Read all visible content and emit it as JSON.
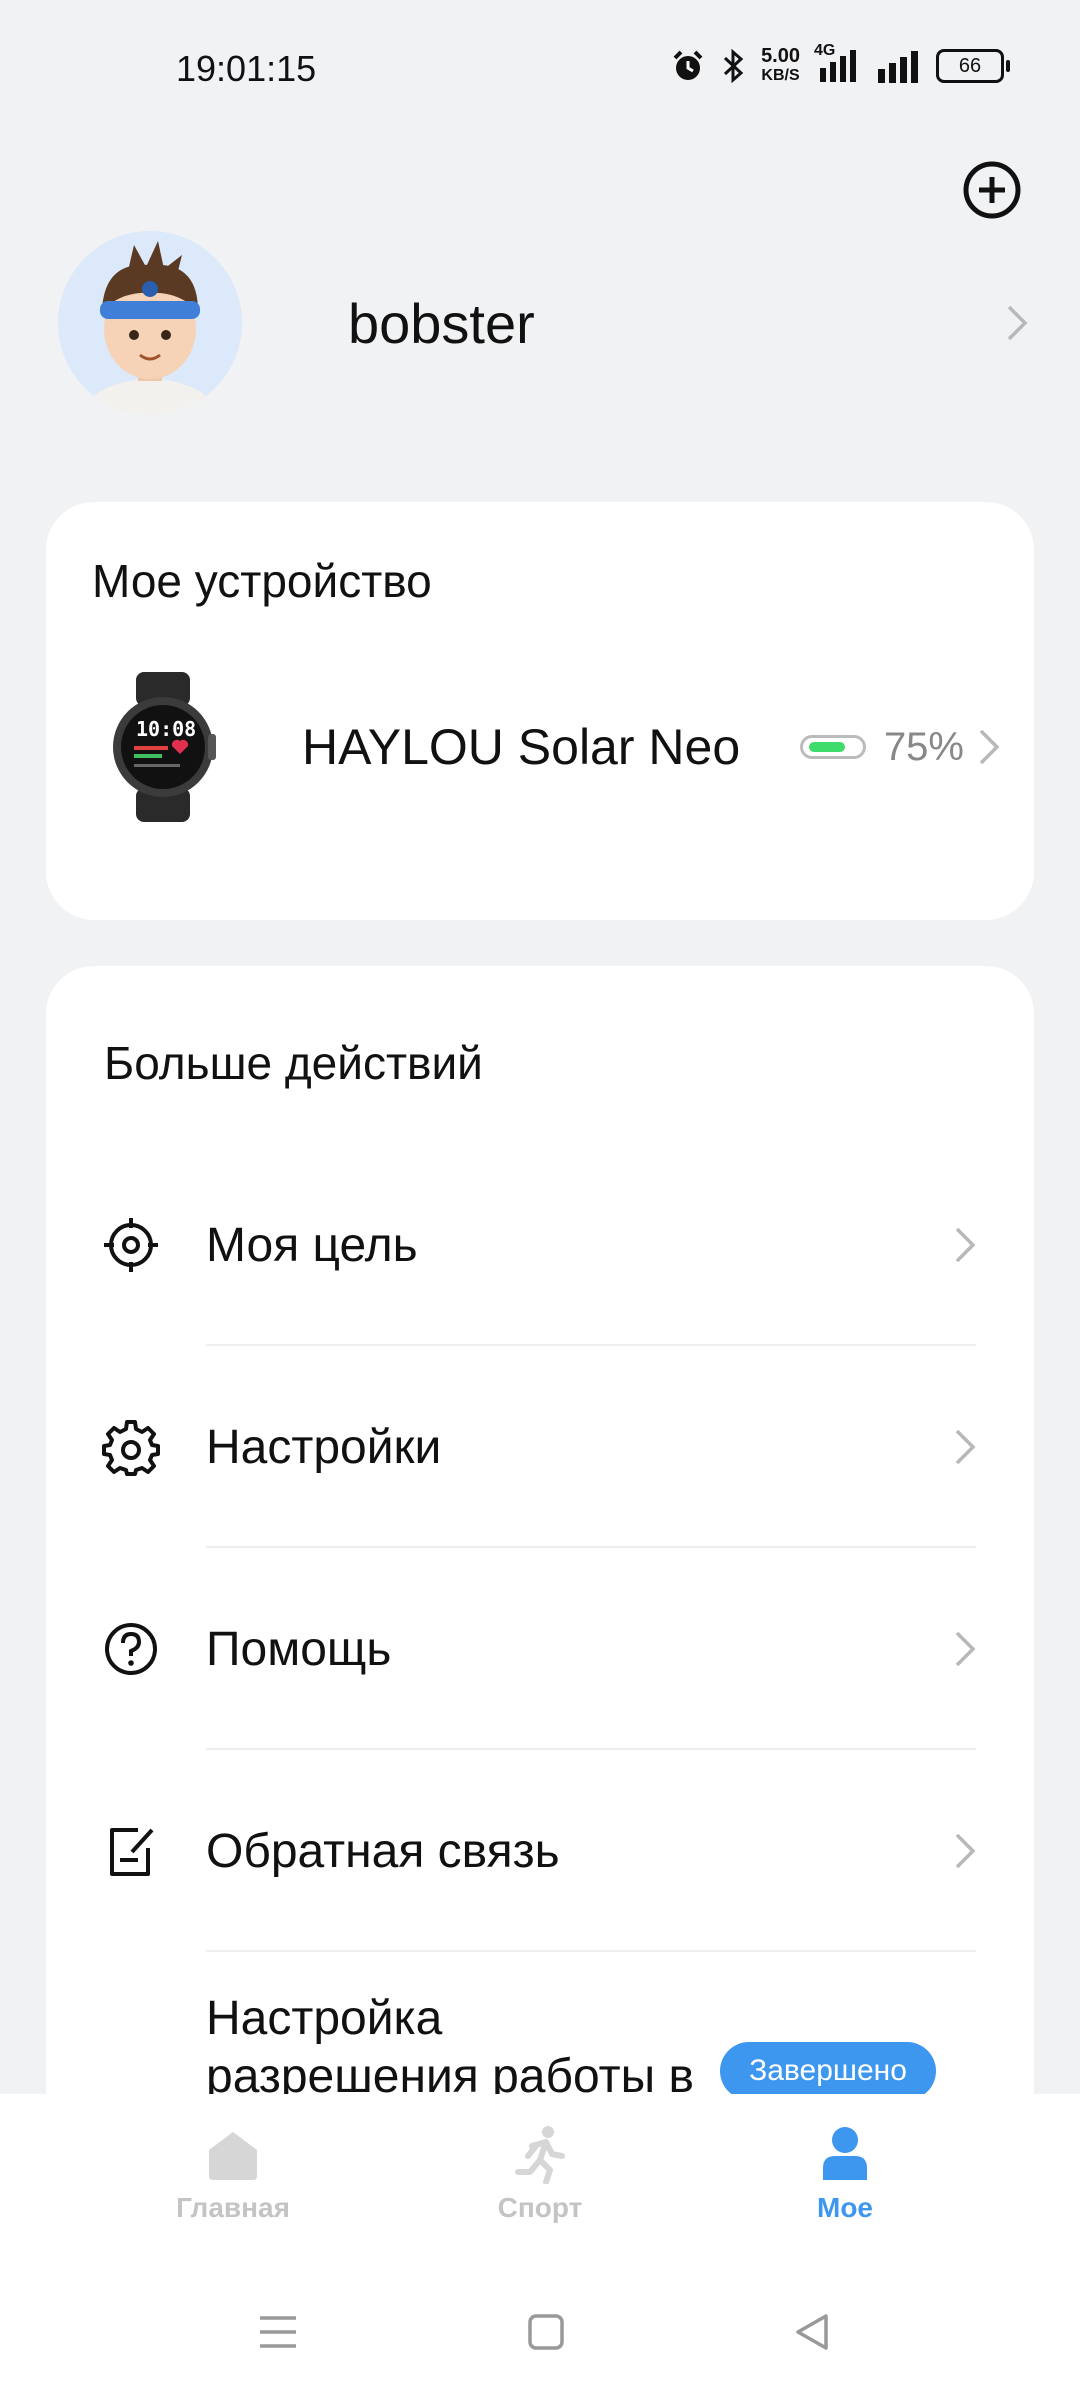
{
  "status_bar": {
    "time": "19:01:15",
    "net_speed_value": "5.00",
    "net_speed_unit": "KB/S",
    "network": "4G",
    "battery": "66"
  },
  "profile": {
    "username": "bobster"
  },
  "device_card": {
    "title": "Мое устройство",
    "device_name": "HAYLOU Solar Neo",
    "battery_percent": "75%",
    "battery_level": 0.75
  },
  "actions_card": {
    "title": "Больше действий",
    "items": [
      {
        "label": "Моя цель",
        "icon": "target-icon"
      },
      {
        "label": "Настройки",
        "icon": "gear-icon"
      },
      {
        "label": "Помощь",
        "icon": "help-icon"
      },
      {
        "label": "Обратная связь",
        "icon": "feedback-icon"
      },
      {
        "label": "Настройка разрешения работы в фоне",
        "icon": "shield-icon",
        "badge": "Завершено"
      }
    ]
  },
  "bottom_nav": {
    "tabs": [
      {
        "label": "Главная",
        "icon": "home-icon",
        "active": false
      },
      {
        "label": "Спорт",
        "icon": "running-icon",
        "active": false
      },
      {
        "label": "Мое",
        "icon": "person-icon",
        "active": true
      }
    ]
  },
  "colors": {
    "accent": "#3d97ef",
    "battery_green": "#3ddc6b",
    "background": "#f1f2f4"
  }
}
